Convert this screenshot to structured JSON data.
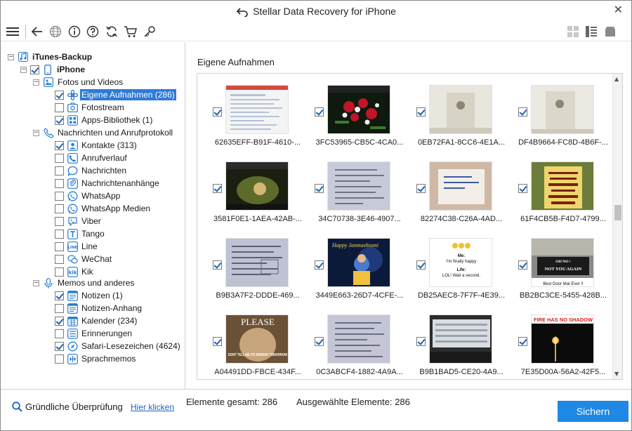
{
  "window": {
    "title": "Stellar Data Recovery for iPhone",
    "close_glyph": "✕"
  },
  "toolbar": {
    "icons": [
      "menu-icon",
      "back-icon",
      "globe-icon",
      "info-icon",
      "help-icon",
      "refresh-icon",
      "cart-icon",
      "key-icon",
      "grid-view-icon",
      "list-view-icon",
      "drive-icon"
    ]
  },
  "tree": {
    "root": {
      "label": "iTunes-Backup",
      "expander": "−"
    },
    "device": {
      "label": "iPhone",
      "expander": "−"
    },
    "groups": [
      {
        "label": "Fotos und Videos",
        "expander": "−",
        "icon": "photo-icon",
        "items": [
          {
            "label": "Eigene Aufnahmen (286)",
            "checked": true,
            "icon": "camera-roll-icon",
            "selected": true
          },
          {
            "label": "Fotostream",
            "checked": false,
            "icon": "photostream-icon"
          },
          {
            "label": "Apps-Bibliothek (1)",
            "checked": true,
            "icon": "app-library-icon"
          }
        ]
      },
      {
        "label": "Nachrichten und Anrufprotokoll",
        "expander": "−",
        "icon": "phone-icon",
        "items": [
          {
            "label": "Kontakte (313)",
            "checked": true,
            "icon": "contacts-icon"
          },
          {
            "label": "Anrufverlauf",
            "checked": false,
            "icon": "call-history-icon"
          },
          {
            "label": "Nachrichten",
            "checked": false,
            "icon": "messages-icon"
          },
          {
            "label": "Nachrichtenanhänge",
            "checked": false,
            "icon": "attachments-icon"
          },
          {
            "label": "WhatsApp",
            "checked": false,
            "icon": "whatsapp-icon"
          },
          {
            "label": "WhatsApp Medien",
            "checked": false,
            "icon": "whatsapp-media-icon"
          },
          {
            "label": "Viber",
            "checked": false,
            "icon": "viber-icon"
          },
          {
            "label": "Tango",
            "checked": false,
            "icon": "tango-icon"
          },
          {
            "label": "Line",
            "checked": false,
            "icon": "line-icon"
          },
          {
            "label": "WeChat",
            "checked": false,
            "icon": "wechat-icon"
          },
          {
            "label": "Kik",
            "checked": false,
            "icon": "kik-icon"
          }
        ]
      },
      {
        "label": "Memos und anderes",
        "expander": "−",
        "icon": "microphone-icon",
        "items": [
          {
            "label": "Notizen (1)",
            "checked": true,
            "icon": "notes-icon"
          },
          {
            "label": "Notizen-Anhang",
            "checked": false,
            "icon": "notes-attachment-icon"
          },
          {
            "label": "Kalender (234)",
            "checked": true,
            "icon": "calendar-icon"
          },
          {
            "label": "Erinnerungen",
            "checked": false,
            "icon": "reminders-icon"
          },
          {
            "label": "Safari-Lesezeichen (4624)",
            "checked": true,
            "icon": "safari-icon"
          },
          {
            "label": "Sprachmemos",
            "checked": false,
            "icon": "voice-memo-icon"
          }
        ]
      }
    ]
  },
  "main": {
    "section_title": "Eigene Aufnahmen",
    "thumbnails": [
      {
        "name": "62635EFF-B91F-4610-...",
        "checked": true,
        "kind": "screenshot-web"
      },
      {
        "name": "3FC53965-CB5C-4CA0...",
        "checked": true,
        "kind": "flowers"
      },
      {
        "name": "0EB72FA1-8CC6-4E1A...",
        "checked": true,
        "kind": "wall-light"
      },
      {
        "name": "DF4B9664-FC8D-4B6F-...",
        "checked": true,
        "kind": "wall-light"
      },
      {
        "name": "3581F0E1-1AEA-42AB-...",
        "checked": true,
        "kind": "green-dark"
      },
      {
        "name": "34C70738-3E46-4907...",
        "checked": true,
        "kind": "paper"
      },
      {
        "name": "82274C38-C26A-4AD...",
        "checked": true,
        "kind": "card"
      },
      {
        "name": "61F4CB5B-F4D7-4799...",
        "checked": true,
        "kind": "poster"
      },
      {
        "name": "B9B3A7F2-DDDE-469...",
        "checked": true,
        "kind": "paper"
      },
      {
        "name": "3449E663-26D7-4CFE-...",
        "checked": true,
        "kind": "krishna",
        "caption": "Happy Janmashtami"
      },
      {
        "name": "DB25AEC8-7F7F-4E39...",
        "checked": true,
        "kind": "meme",
        "caption_lines": [
          "Me:",
          "I'm finally happy",
          "Life:",
          "LOL! Wait a second."
        ]
      },
      {
        "name": "BB2BC3CE-5455-428B...",
        "checked": true,
        "kind": "door",
        "caption_lines": [
          "OH NO !",
          "NOT YOU AGAIN",
          "Best Door Mat Ever !!"
        ]
      },
      {
        "name": "A04491DD-FBCE-434F...",
        "checked": true,
        "kind": "please",
        "caption_lines": [
          "PLEASE",
          "DONT TELL ME ITS MONDAY TOMORROW"
        ]
      },
      {
        "name": "0C3ABCF4-1882-4A9A...",
        "checked": true,
        "kind": "paper"
      },
      {
        "name": "B9B1BAD5-CE20-4A9...",
        "checked": true,
        "kind": "monitor"
      },
      {
        "name": "7E35D00A-56A2-42F5...",
        "checked": true,
        "kind": "fire",
        "caption_lines": [
          "FIRE HAS NO SHADOW"
        ]
      }
    ],
    "scroll_position": 0.48
  },
  "bottom": {
    "deep_scan_label": "Gründliche Überprüfung",
    "deep_scan_link": "Hier klicken",
    "total_label": "Elemente gesamt: 286",
    "selected_label": "Ausgewählte Elemente: 286",
    "save_button": "Sichern"
  },
  "colors": {
    "accent": "#1e88e5",
    "selection": "#2f7bd6",
    "link": "#1f62c4",
    "icon_blue": "#2a7bd0"
  }
}
